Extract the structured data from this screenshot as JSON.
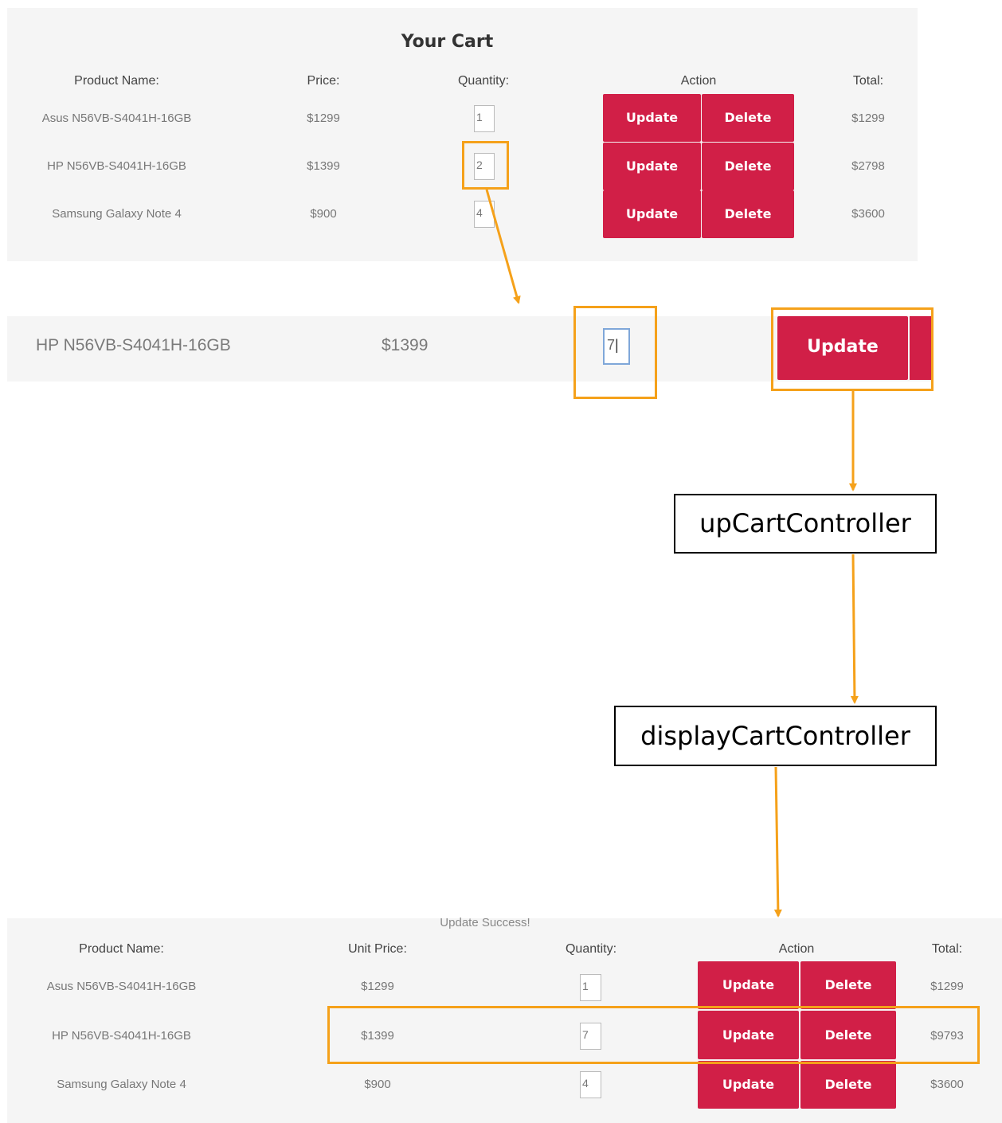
{
  "cart_before": {
    "title": "Your Cart",
    "headers": {
      "name": "Product Name:",
      "price": "Price:",
      "quantity": "Quantity:",
      "action": "Action",
      "total": "Total:"
    },
    "rows": [
      {
        "name": "Asus N56VB-S4041H-16GB",
        "price": "$1299",
        "quantity": "1",
        "total": "$1299"
      },
      {
        "name": "HP N56VB-S4041H-16GB",
        "price": "$1399",
        "quantity": "2",
        "total": "$2798"
      },
      {
        "name": "Samsung Galaxy Note 4",
        "price": "$900",
        "quantity": "4",
        "total": "$3600"
      }
    ],
    "update_label": "Update",
    "delete_label": "Delete"
  },
  "zoom_row": {
    "name": "HP N56VB-S4041H-16GB",
    "price": "$1399",
    "quantity": "7",
    "update_label": "Update"
  },
  "controllers": {
    "first": "upCartController",
    "second": "displayCartController"
  },
  "cart_after": {
    "message": "Update Success!",
    "headers": {
      "name": "Product Name:",
      "price": "Unit Price:",
      "quantity": "Quantity:",
      "action": "Action",
      "total": "Total:"
    },
    "rows": [
      {
        "name": "Asus N56VB-S4041H-16GB",
        "price": "$1299",
        "quantity": "1",
        "total": "$1299"
      },
      {
        "name": "HP N56VB-S4041H-16GB",
        "price": "$1399",
        "quantity": "7",
        "total": "$9793"
      },
      {
        "name": "Samsung Galaxy Note 4",
        "price": "$900",
        "quantity": "4",
        "total": "$3600"
      }
    ],
    "update_label": "Update",
    "delete_label": "Delete"
  },
  "colors": {
    "highlight": "#f5a11a",
    "button": "#d11f47",
    "panel_bg": "#f5f5f5"
  }
}
